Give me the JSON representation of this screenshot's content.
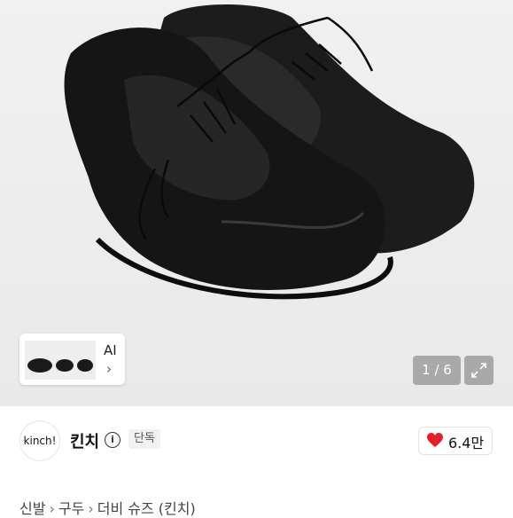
{
  "gallery": {
    "counter": "1 / 6",
    "thumb_label": "AI",
    "thumb_arrow": "›",
    "icons": [
      "expand-icon"
    ]
  },
  "store": {
    "avatar_text": "kinch!",
    "name": "킨치",
    "badge": "단독",
    "like_count": "6.4만",
    "like_color": "#e0202b"
  },
  "breadcrumb": {
    "items": [
      "신발",
      "구두",
      "더비 슈즈 (킨치)"
    ],
    "separator": "›"
  }
}
